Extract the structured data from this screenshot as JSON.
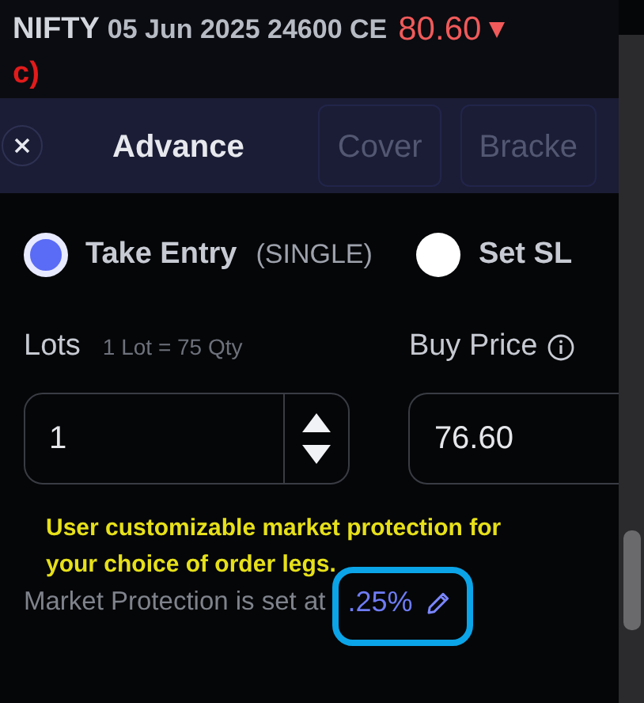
{
  "header": {
    "symbol": "NIFTY",
    "contract": "05 Jun 2025 24600 CE",
    "price": "80.60"
  },
  "annotation_label": "c)",
  "tabs": [
    {
      "label": "Advance",
      "selected": true
    },
    {
      "label": "Cover",
      "selected": false
    },
    {
      "label": "Bracke",
      "selected": false
    }
  ],
  "entry_options": [
    {
      "label": "Take Entry",
      "note": "(SINGLE)",
      "selected": true
    },
    {
      "label": "Set SL",
      "selected": false
    }
  ],
  "lots": {
    "label": "Lots",
    "hint": "1 Lot = 75 Qty",
    "value": "1"
  },
  "buy_price": {
    "label": "Buy Price",
    "value": "76.60"
  },
  "annotation_note": "User customizable market protection for your choice of order legs.",
  "market_protection": {
    "text": "Market Protection is set at",
    "value": ".25%"
  }
}
